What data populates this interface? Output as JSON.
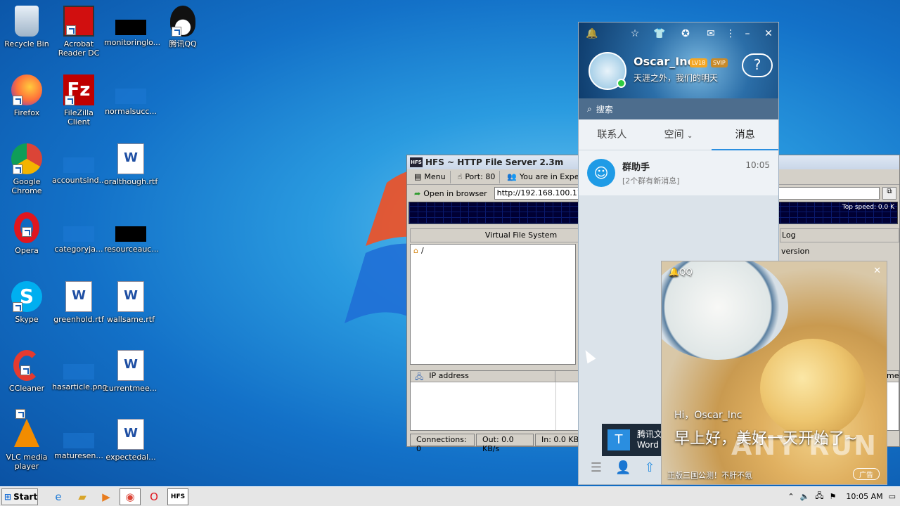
{
  "desktop": {
    "icons": [
      {
        "label": "Recycle Bin"
      },
      {
        "label": "Acrobat Reader DC"
      },
      {
        "label": "monitoringlo..."
      },
      {
        "label": "腾讯QQ"
      },
      {
        "label": "Firefox"
      },
      {
        "label": "FileZilla Client"
      },
      {
        "label": "normalsucc..."
      },
      {
        "label": "Google Chrome"
      },
      {
        "label": "accountsind..."
      },
      {
        "label": "oralthough.rtf"
      },
      {
        "label": "Opera"
      },
      {
        "label": "categoryja..."
      },
      {
        "label": "resourceauc..."
      },
      {
        "label": "Skype"
      },
      {
        "label": "greenhold.rtf"
      },
      {
        "label": "wallsame.rtf"
      },
      {
        "label": "CCleaner"
      },
      {
        "label": "hasarticle.png"
      },
      {
        "label": "currentmee..."
      },
      {
        "label": "VLC media player"
      },
      {
        "label": "maturesen..."
      },
      {
        "label": "expectedal..."
      }
    ]
  },
  "hfs": {
    "title": "HFS ~ HTTP File Server 2.3m",
    "menu_label": "Menu",
    "port_label": "Port: 80",
    "mode_label": "You are in Expe",
    "open_browser_label": "Open in browser",
    "url": "http://192.168.100.177/",
    "top_speed": "Top speed: 0.0 K",
    "vfs_header": "Virtual File System",
    "vfs_root": "/",
    "log_header": "Log",
    "log_line": "version",
    "ip_header": "IP address",
    "time_header": "ime",
    "status": {
      "connections": "Connections: 0",
      "out": "Out: 0.0 KB/s",
      "in": "In: 0.0 KB"
    }
  },
  "qq": {
    "username": "Oscar_Inc",
    "level_badge": "LV18",
    "vip_badge": "SVIP",
    "motto": "天涯之外，我们的明天",
    "search_placeholder": "搜索",
    "tabs": [
      "联系人",
      "空间",
      "消息"
    ],
    "conversation": {
      "name": "群助手",
      "subtitle": "[2个群有新消息]",
      "time": "10:05"
    }
  },
  "tooltip": {
    "line1": "腾讯文",
    "line2": "Word"
  },
  "ad": {
    "brand": "QQ",
    "greeting": "Hi，Oscar_Inc",
    "headline": "早上好，美好一天开始了~",
    "footer": "正版三国公测！不肝不氪",
    "tag": "广告"
  },
  "watermark": "ANY RUN",
  "taskbar": {
    "start_label": "Start",
    "clock": "10:05 AM"
  }
}
